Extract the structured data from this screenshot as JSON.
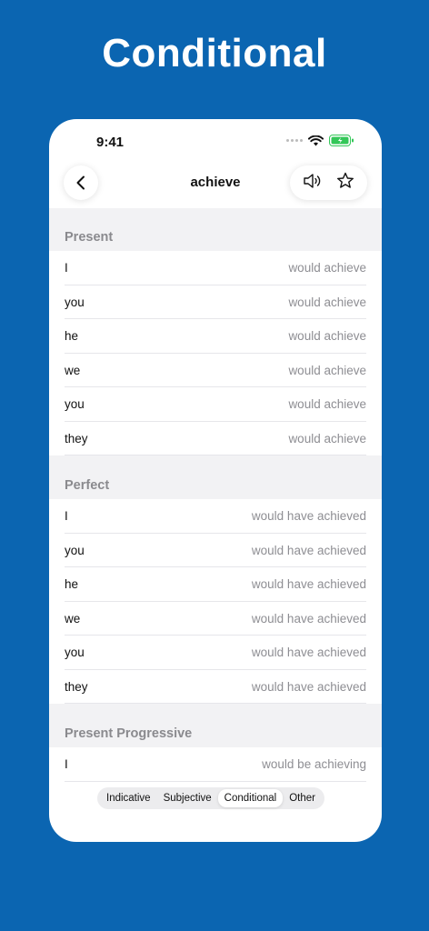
{
  "promo_title": "Conditional",
  "status": {
    "time": "9:41"
  },
  "nav": {
    "title": "achieve",
    "back_icon": "chevron-left-icon",
    "speaker_icon": "speaker-icon",
    "star_icon": "star-icon"
  },
  "sections": [
    {
      "title": "Present",
      "rows": [
        {
          "pronoun": "I",
          "form": "would achieve"
        },
        {
          "pronoun": "you",
          "form": "would achieve"
        },
        {
          "pronoun": "he",
          "form": "would achieve"
        },
        {
          "pronoun": "we",
          "form": "would achieve"
        },
        {
          "pronoun": "you",
          "form": "would achieve"
        },
        {
          "pronoun": "they",
          "form": "would achieve"
        }
      ]
    },
    {
      "title": "Perfect",
      "rows": [
        {
          "pronoun": "I",
          "form": "would have achieved"
        },
        {
          "pronoun": "you",
          "form": "would have achieved"
        },
        {
          "pronoun": "he",
          "form": "would have achieved"
        },
        {
          "pronoun": "we",
          "form": "would have achieved"
        },
        {
          "pronoun": "you",
          "form": "would have achieved"
        },
        {
          "pronoun": "they",
          "form": "would have achieved"
        }
      ]
    },
    {
      "title": "Present Progressive",
      "rows": [
        {
          "pronoun": "I",
          "form": "would be achieving"
        }
      ]
    }
  ],
  "tabs": [
    {
      "label": "Indicative",
      "active": false
    },
    {
      "label": "Subjective",
      "active": false
    },
    {
      "label": "Conditional",
      "active": true
    },
    {
      "label": "Other",
      "active": false
    }
  ],
  "colors": {
    "background": "#0b65b1",
    "section_bg": "#f2f2f4",
    "battery": "#34c759"
  }
}
